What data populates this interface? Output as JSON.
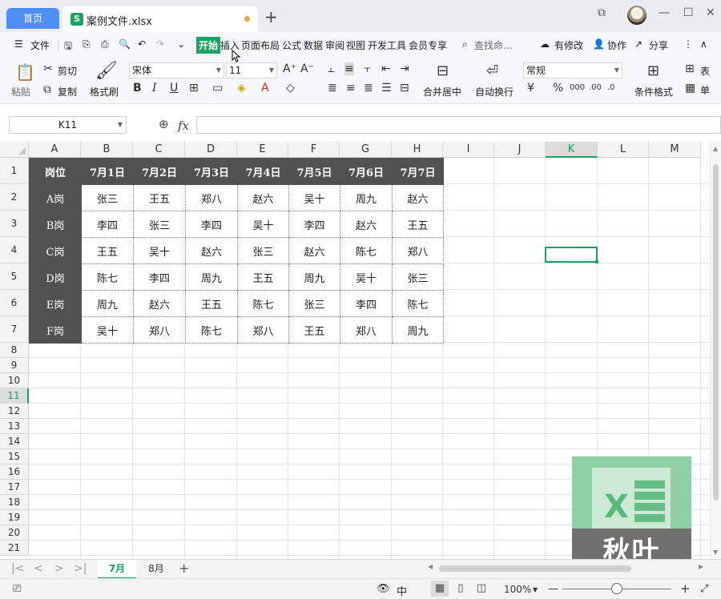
{
  "titlebar": {
    "home_tab": "首页",
    "file_tab": "案例文件.xlsx",
    "file_icon": "S",
    "new_tab": "+"
  },
  "menubar": {
    "file": "文件",
    "items": [
      "开始",
      "插入",
      "页面布局",
      "公式",
      "数据",
      "审阅",
      "视图",
      "开发工具",
      "会员专享"
    ],
    "search_placeholder": "查找命...",
    "right": {
      "changes": "有修改",
      "collab": "协作",
      "share": "分享"
    }
  },
  "ribbon": {
    "paste": "粘贴",
    "cut": "剪切",
    "copy": "复制",
    "format_painter": "格式刷",
    "font_name": "宋体",
    "font_size": "11",
    "merge_center": "合并居中",
    "wrap_text": "自动换行",
    "number_format": "常规",
    "conditional_format": "条件格式",
    "table_style": "表",
    "cell_style": "单"
  },
  "formula_bar": {
    "name_box": "K11",
    "fx": "fx",
    "formula": ""
  },
  "grid": {
    "columns": [
      "A",
      "B",
      "C",
      "D",
      "E",
      "F",
      "G",
      "H",
      "I",
      "J",
      "K",
      "L",
      "M"
    ],
    "selected_column": "K",
    "rows": [
      "1",
      "2",
      "3",
      "4",
      "5",
      "6",
      "7",
      "8",
      "9",
      "10",
      "11",
      "12",
      "13",
      "14",
      "15",
      "16",
      "17",
      "18",
      "19",
      "20",
      "21"
    ],
    "selected_row": "11",
    "active_cell": "K11"
  },
  "table": {
    "header": [
      "岗位",
      "7月1日",
      "7月2日",
      "7月3日",
      "7月4日",
      "7月5日",
      "7月6日",
      "7月7日"
    ],
    "rows": [
      [
        "A岗",
        "张三",
        "王五",
        "郑八",
        "赵六",
        "吴十",
        "周九",
        "赵六"
      ],
      [
        "B岗",
        "李四",
        "张三",
        "李四",
        "吴十",
        "李四",
        "赵六",
        "王五"
      ],
      [
        "C岗",
        "王五",
        "吴十",
        "赵六",
        "张三",
        "赵六",
        "陈七",
        "郑八"
      ],
      [
        "D岗",
        "陈七",
        "李四",
        "周九",
        "王五",
        "周九",
        "吴十",
        "张三"
      ],
      [
        "E岗",
        "周九",
        "赵六",
        "王五",
        "陈七",
        "张三",
        "李四",
        "陈七"
      ],
      [
        "F岗",
        "吴十",
        "郑八",
        "陈七",
        "郑八",
        "王五",
        "郑八",
        "周九"
      ]
    ]
  },
  "watermark": {
    "text": "秋叶",
    "letter": "X"
  },
  "sheets": {
    "tabs": [
      "7月",
      "8月"
    ],
    "active": "7月",
    "add": "+"
  },
  "statusbar": {
    "zoom": "100%",
    "lang": "中"
  },
  "colors": {
    "accent": "#1aa260",
    "header_fill": "#515151",
    "home_tab": "#4e8ef7"
  }
}
